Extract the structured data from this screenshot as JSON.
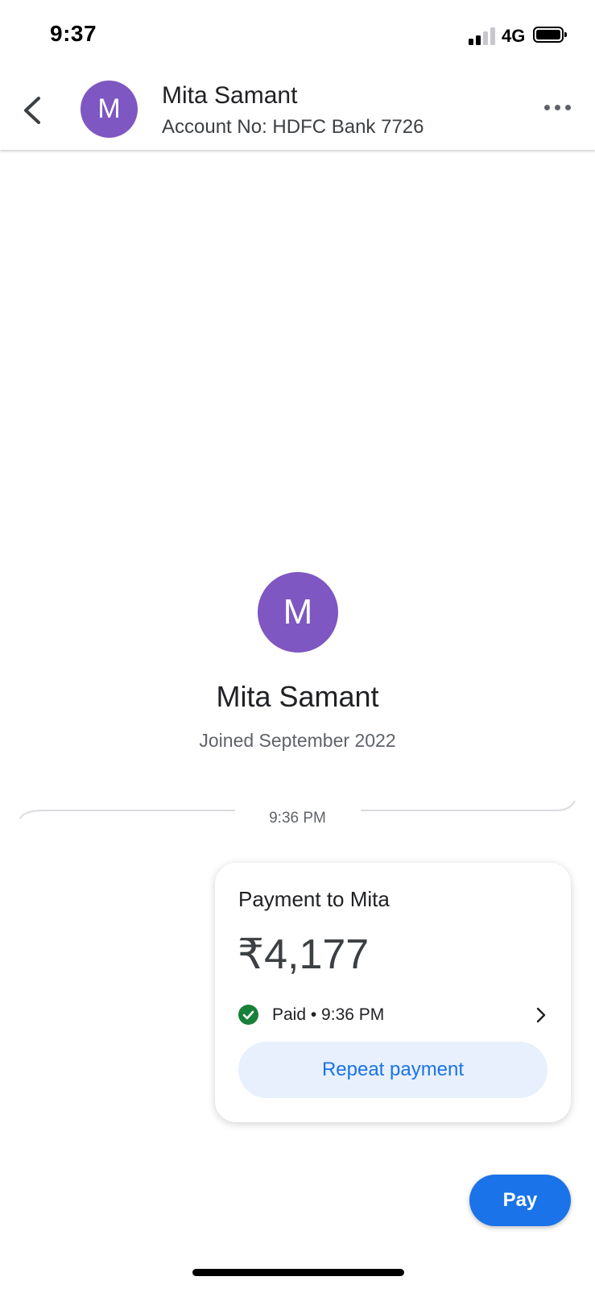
{
  "status_bar": {
    "time": "9:37",
    "network": "4G",
    "icons": [
      "signal-icon",
      "battery-icon"
    ]
  },
  "header": {
    "avatar_letter": "M",
    "name": "Mita Samant",
    "account": "Account No: HDFC Bank 7726",
    "icons": [
      "back-arrow-icon",
      "more-options-icon"
    ]
  },
  "profile": {
    "avatar_letter": "M",
    "name": "Mita Samant",
    "joined": "Joined September 2022"
  },
  "chat": {
    "divider_time": "9:36 PM"
  },
  "payment_card": {
    "title": "Payment to Mita",
    "amount": "₹4,177",
    "status": "Paid • 9:36 PM",
    "repeat_label": "Repeat payment",
    "icons": [
      "check-circle-icon",
      "chevron-right-icon"
    ]
  },
  "pay_button": {
    "label": "Pay"
  },
  "colors": {
    "avatar": "#7e57c2",
    "primary": "#1a73e8",
    "repeat_bg": "#e8f0fe",
    "success": "#188038"
  }
}
